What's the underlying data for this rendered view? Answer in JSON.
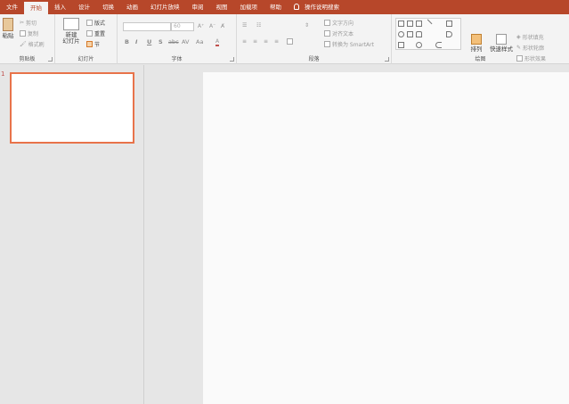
{
  "tabs": [
    {
      "label": "文件"
    },
    {
      "label": "开始"
    },
    {
      "label": "插入"
    },
    {
      "label": "设计"
    },
    {
      "label": "切换"
    },
    {
      "label": "动画"
    },
    {
      "label": "幻灯片放映"
    },
    {
      "label": "审阅"
    },
    {
      "label": "视图"
    },
    {
      "label": "加载项"
    },
    {
      "label": "帮助"
    }
  ],
  "search_label": "操作说明搜索",
  "clipboard": {
    "paste": "粘贴",
    "cut": "剪切",
    "copy": "复制",
    "format_painter": "格式刷",
    "group_label": "剪贴板"
  },
  "slides": {
    "new_slide_line1": "新建",
    "new_slide_line2": "幻灯片",
    "layout": "版式",
    "reset": "重置",
    "section": "节",
    "group_label": "幻灯片"
  },
  "font": {
    "font_name": "",
    "font_size": "60",
    "bold": "B",
    "italic": "I",
    "underline": "U",
    "shadow": "S",
    "strike": "abc",
    "spacing": "AV",
    "case": "Aa",
    "group_label": "字体"
  },
  "paragraph": {
    "text_direction": "文字方向",
    "align_text": "对齐文本",
    "smartart": "转换为 SmartArt",
    "group_label": "段落"
  },
  "drawing": {
    "arrange": "排列",
    "quick_styles": "快速样式",
    "shape_fill": "形状填充",
    "shape_outline": "形状轮廓",
    "shape_effects": "形状效果",
    "group_label": "绘图"
  },
  "slide_panel": {
    "slide_number": "1"
  }
}
